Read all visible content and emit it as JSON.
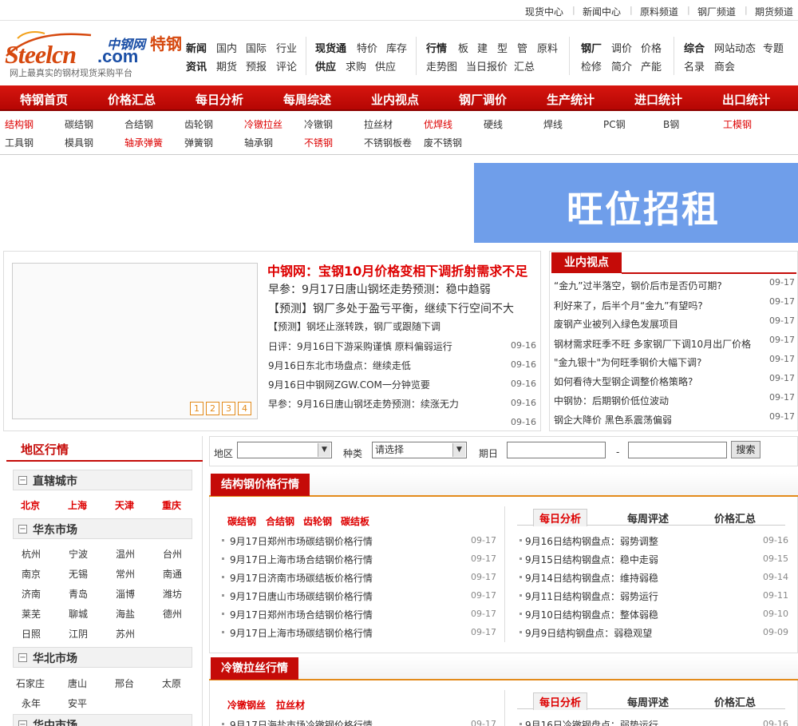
{
  "topbar": {
    "links": [
      "现货中心",
      "新闻中心",
      "原料频道",
      "钢厂频道",
      "期货频道"
    ]
  },
  "logo": {
    "cn_name": "中钢网",
    "brand_main": "Steelcn",
    "brand_com": ".com",
    "tegang": "特钢",
    "slogan": "网上最真实的钢材现货采购平台"
  },
  "nav": {
    "group1": {
      "t1": "新闻",
      "l1": [
        "国内",
        "国际",
        "行业"
      ],
      "t2": "资讯",
      "l2": [
        "期货",
        "预报",
        "评论"
      ]
    },
    "group2": {
      "t1": "现货通",
      "l1": [
        "特价",
        "库存"
      ],
      "t2": "供应",
      "l2": [
        "求购",
        "供应"
      ]
    },
    "group3": {
      "t1": "行情",
      "l1": [
        "板",
        "建",
        "型",
        "管",
        "原料"
      ],
      "l2": [
        "走势图",
        "当日报价",
        "汇总"
      ]
    },
    "group4": {
      "t1": "钢厂",
      "l1": [
        "调价",
        "价格"
      ],
      "l2": [
        "检修",
        "简介",
        "产能"
      ]
    },
    "group5": {
      "t1": "综合",
      "l1": [
        "网站动态",
        "专题"
      ],
      "l2": [
        "名录",
        "商会"
      ]
    }
  },
  "menu": [
    "特钢首页",
    "价格汇总",
    "每日分析",
    "每周综述",
    "业内视点",
    "钢厂调价",
    "生产统计",
    "进口统计",
    "出口统计"
  ],
  "subcats": {
    "row1": [
      "结构钢",
      "碳结钢",
      "合结钢",
      "齿轮钢",
      "冷镦拉丝",
      "冷镦钢",
      "拉丝材",
      "优焊线",
      "硬线",
      "焊线",
      "PC钢",
      "B钢",
      "工模钢"
    ],
    "row2": [
      "工具钢",
      "模具钢",
      "轴承弹簧",
      "弹簧钢",
      "轴承钢",
      "不锈钢",
      "不锈钢板卷",
      "废不锈钢"
    ]
  },
  "banner": {
    "text": "旺位招租"
  },
  "news": {
    "headline": "中钢网：宝钢10月价格变相下调折射需求不足",
    "lines_big": [
      "早参：9月17日唐山钢坯走势预测：稳中趋弱",
      "【预测】钢厂多处于盈亏平衡，继续下行空间不大"
    ],
    "line_plain": "【预测】钢坯止涨转跌，钢厂或跟随下调",
    "items": [
      {
        "title": "日评：9月16日下游采购谨慎 原料偏弱运行",
        "date": "09-16"
      },
      {
        "title": "9月16日东北市场盘点：继续走低",
        "date": "09-16"
      },
      {
        "title": "9月16日中钢网ZGW.COM一分钟览要",
        "date": "09-16"
      },
      {
        "title": "早参：9月16日唐山钢坯走势预测：续涨无力",
        "date": "09-16"
      },
      {
        "title": "",
        "date": "09-16"
      }
    ],
    "pages": [
      "1",
      "2",
      "3",
      "4"
    ]
  },
  "views": {
    "title": "业内视点",
    "items": [
      {
        "title": "“金九”过半落空，钢价后市是否仍可期?",
        "date": "09-17"
      },
      {
        "title": "利好来了，后半个月“金九”有望吗?",
        "date": "09-17"
      },
      {
        "title": "废钢产业被列入绿色发展项目",
        "date": "09-17"
      },
      {
        "title": "钢材需求旺季不旺 多家钢厂下调10月出厂价格",
        "date": "09-17"
      },
      {
        "title": "\"金九银十\"为何旺季钢价大幅下调?",
        "date": "09-17"
      },
      {
        "title": "如何看待大型钢企调整价格策略?",
        "date": "09-17"
      },
      {
        "title": "中钢协：后期钢价低位波动",
        "date": "09-17"
      },
      {
        "title": "钢企大降价 黑色系震荡偏弱",
        "date": "09-17"
      }
    ]
  },
  "region": {
    "title": "地区行情",
    "groups": [
      {
        "name": "直辖城市",
        "cities": [
          "北京",
          "上海",
          "天津",
          "重庆"
        ]
      },
      {
        "name": "华东市场",
        "cities": [
          "杭州",
          "宁波",
          "温州",
          "台州",
          "南京",
          "无锡",
          "常州",
          "南通",
          "济南",
          "青岛",
          "淄博",
          "潍坊",
          "莱芜",
          "聊城",
          "海盐",
          "德州",
          "日照",
          "江阴",
          "苏州"
        ]
      },
      {
        "name": "华北市场",
        "cities": [
          "石家庄",
          "唐山",
          "邢台",
          "太原",
          "永年",
          "安平"
        ]
      },
      {
        "name": "华中市场",
        "cities": []
      }
    ]
  },
  "search": {
    "region_label": "地区",
    "region_value": "",
    "type_label": "种类",
    "type_value": "请选择",
    "date_label": "期日",
    "date_sep": "-",
    "button": "搜索"
  },
  "sec1": {
    "title": "结构钢价格行情",
    "cats": [
      "碳结钢",
      "合结钢",
      "齿轮钢",
      "碳结板"
    ],
    "items": [
      {
        "title": "9月17日郑州市场碳结钢价格行情",
        "date": "09-17"
      },
      {
        "title": "9月17日上海市场合结钢价格行情",
        "date": "09-17"
      },
      {
        "title": "9月17日济南市场碳结板价格行情",
        "date": "09-17"
      },
      {
        "title": "9月17日唐山市场碳结钢价格行情",
        "date": "09-17"
      },
      {
        "title": "9月17日郑州市场合结钢价格行情",
        "date": "09-17"
      },
      {
        "title": "9月17日上海市场碳结钢价格行情",
        "date": "09-17"
      }
    ],
    "tabs": [
      "每日分析",
      "每周评述",
      "价格汇总"
    ],
    "right": [
      {
        "title": "9月16日结构钢盘点：弱势调整",
        "date": "09-16"
      },
      {
        "title": "9月15日结构钢盘点：稳中走弱",
        "date": "09-15"
      },
      {
        "title": "9月14日结构钢盘点：维持弱稳",
        "date": "09-14"
      },
      {
        "title": "9月11日结构钢盘点：弱势运行",
        "date": "09-11"
      },
      {
        "title": "9月10日结构钢盘点：整体弱稳",
        "date": "09-10"
      },
      {
        "title": "9月9日结构钢盘点：弱稳观望",
        "date": "09-09"
      }
    ]
  },
  "sec2": {
    "title": "冷镦拉丝行情",
    "cats": [
      "冷镦钢丝",
      "拉丝材"
    ],
    "items": [
      {
        "title": "9月17日海盐市场冷镦钢价格行情",
        "date": "09-17"
      }
    ],
    "tabs": [
      "每日分析",
      "每周评述",
      "价格汇总"
    ],
    "right": [
      {
        "title": "9月16日冷镦钢盘点：弱势运行",
        "date": "09-16"
      }
    ]
  }
}
